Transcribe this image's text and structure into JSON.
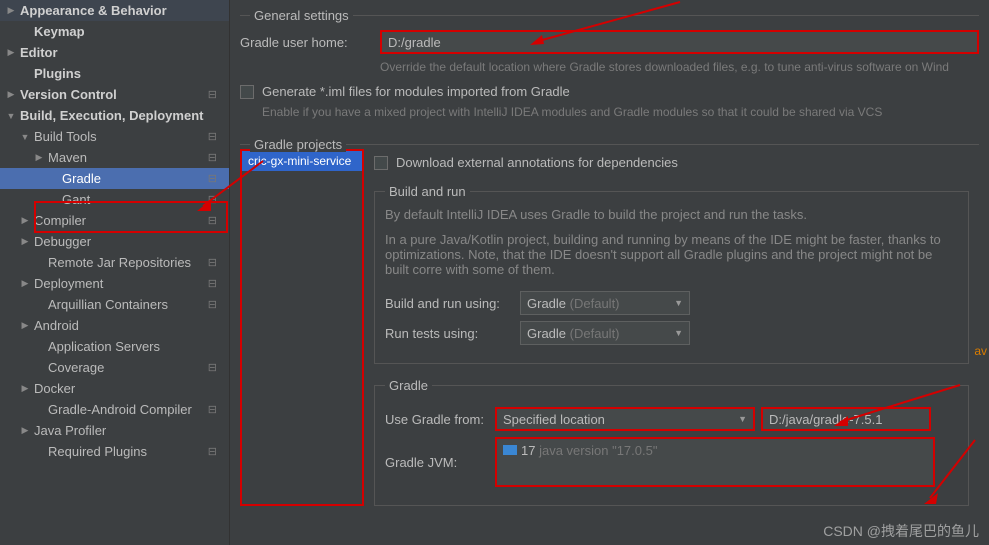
{
  "sidebar": {
    "items": [
      {
        "label": "Appearance & Behavior",
        "bold": true,
        "arrow": "right",
        "pad": 0,
        "lock": false
      },
      {
        "label": "Keymap",
        "bold": true,
        "arrow": "none",
        "pad": 1,
        "lock": false
      },
      {
        "label": "Editor",
        "bold": true,
        "arrow": "right",
        "pad": 0,
        "lock": false
      },
      {
        "label": "Plugins",
        "bold": true,
        "arrow": "none",
        "pad": 1,
        "lock": false
      },
      {
        "label": "Version Control",
        "bold": true,
        "arrow": "right",
        "pad": 0,
        "lock": true
      },
      {
        "label": "Build, Execution, Deployment",
        "bold": true,
        "arrow": "down",
        "pad": 0,
        "lock": false
      },
      {
        "label": "Build Tools",
        "bold": false,
        "arrow": "down",
        "pad": 1,
        "lock": true
      },
      {
        "label": "Maven",
        "bold": false,
        "arrow": "right",
        "pad": 2,
        "lock": true
      },
      {
        "label": "Gradle",
        "bold": false,
        "arrow": "none",
        "pad": 3,
        "lock": true,
        "selected": true
      },
      {
        "label": "Gant",
        "bold": false,
        "arrow": "none",
        "pad": 3,
        "lock": true
      },
      {
        "label": "Compiler",
        "bold": false,
        "arrow": "right",
        "pad": 1,
        "lock": true
      },
      {
        "label": "Debugger",
        "bold": false,
        "arrow": "right",
        "pad": 1,
        "lock": false
      },
      {
        "label": "Remote Jar Repositories",
        "bold": false,
        "arrow": "none",
        "pad": 2,
        "lock": true
      },
      {
        "label": "Deployment",
        "bold": false,
        "arrow": "right",
        "pad": 1,
        "lock": true
      },
      {
        "label": "Arquillian Containers",
        "bold": false,
        "arrow": "none",
        "pad": 2,
        "lock": true
      },
      {
        "label": "Android",
        "bold": false,
        "arrow": "right",
        "pad": 1,
        "lock": false
      },
      {
        "label": "Application Servers",
        "bold": false,
        "arrow": "none",
        "pad": 2,
        "lock": false
      },
      {
        "label": "Coverage",
        "bold": false,
        "arrow": "none",
        "pad": 2,
        "lock": true
      },
      {
        "label": "Docker",
        "bold": false,
        "arrow": "right",
        "pad": 1,
        "lock": false
      },
      {
        "label": "Gradle-Android Compiler",
        "bold": false,
        "arrow": "none",
        "pad": 2,
        "lock": true
      },
      {
        "label": "Java Profiler",
        "bold": false,
        "arrow": "right",
        "pad": 1,
        "lock": false
      },
      {
        "label": "Required Plugins",
        "bold": false,
        "arrow": "none",
        "pad": 2,
        "lock": true
      }
    ]
  },
  "general": {
    "title": "General settings",
    "user_home_label": "Gradle user home:",
    "user_home_value": "D:/gradle",
    "user_home_help": "Override the default location where Gradle stores downloaded files, e.g. to tune anti-virus software on Wind",
    "iml_label": "Generate *.iml files for modules imported from Gradle",
    "iml_help": "Enable if you have a mixed project with IntelliJ IDEA modules and Gradle modules so that it could be shared via VCS"
  },
  "projects": {
    "title": "Gradle projects",
    "project_name": "cric-gx-mini-service",
    "download_ext": "Download external annotations for dependencies",
    "build_run": {
      "title": "Build and run",
      "desc1": "By default IntelliJ IDEA uses Gradle to build the project and run the tasks.",
      "desc2": "In a pure Java/Kotlin project, building and running by means of the IDE might be faster, thanks to optimizations. Note, that the IDE doesn't support all Gradle plugins and the project might not be built corre with some of them.",
      "build_label": "Build and run using:",
      "build_value": "Gradle",
      "build_suffix": "(Default)",
      "tests_label": "Run tests using:",
      "tests_value": "Gradle",
      "tests_suffix": "(Default)"
    },
    "gradle": {
      "title": "Gradle",
      "use_from_label": "Use Gradle from:",
      "use_from_value": "Specified location",
      "location_value": "D:/java/gradle-7.5.1",
      "jvm_label": "Gradle JVM:",
      "jvm_value": "17",
      "jvm_suffix": "java version \"17.0.5\""
    }
  },
  "side_text": "av",
  "watermark": "CSDN @拽着尾巴的鱼儿"
}
